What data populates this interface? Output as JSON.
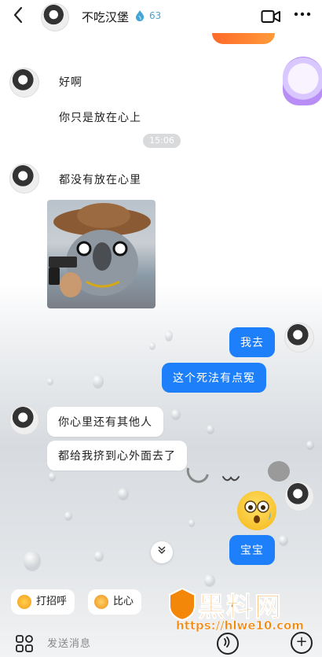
{
  "header": {
    "back_icon": "chevron-left-icon",
    "contact_name": "不吃汉堡",
    "streak_icon": "water-drop-icon",
    "streak_count": "63",
    "video_call_icon": "video-camera-icon",
    "more_icon": "more-dots-icon"
  },
  "messages": [
    {
      "side": "left",
      "text": "好啊"
    },
    {
      "side": "left",
      "text": "你只是放在心上"
    },
    {
      "type": "time",
      "text": "15:06"
    },
    {
      "side": "left",
      "text": "都没有放在心里"
    },
    {
      "side": "left",
      "type": "image"
    },
    {
      "side": "right",
      "text": "我去"
    },
    {
      "side": "right",
      "text": "这个死法有点冤"
    },
    {
      "side": "left",
      "text": "你心里还有其他人"
    },
    {
      "side": "left",
      "text": "都给我挤到心外面去了"
    },
    {
      "side": "right",
      "type": "emoji"
    },
    {
      "side": "right",
      "text": "宝宝"
    }
  ],
  "quick_replies": [
    {
      "label": "打招呼",
      "icon": "wave-emoji-icon"
    },
    {
      "label": "比心",
      "icon": "heart-hands-emoji-icon"
    }
  ],
  "watermark": {
    "brand": "黑料网",
    "url": "https://hlwe10.com"
  },
  "input": {
    "placeholder": "发送消息",
    "apps_icon": "apps-grid-icon",
    "voice_icon": "voice-icon",
    "plus_icon": "plus-icon"
  },
  "colors": {
    "bubble_blue": "#1e7ffa",
    "streak": "#4aa6c8",
    "watermark": "#f2870a"
  }
}
